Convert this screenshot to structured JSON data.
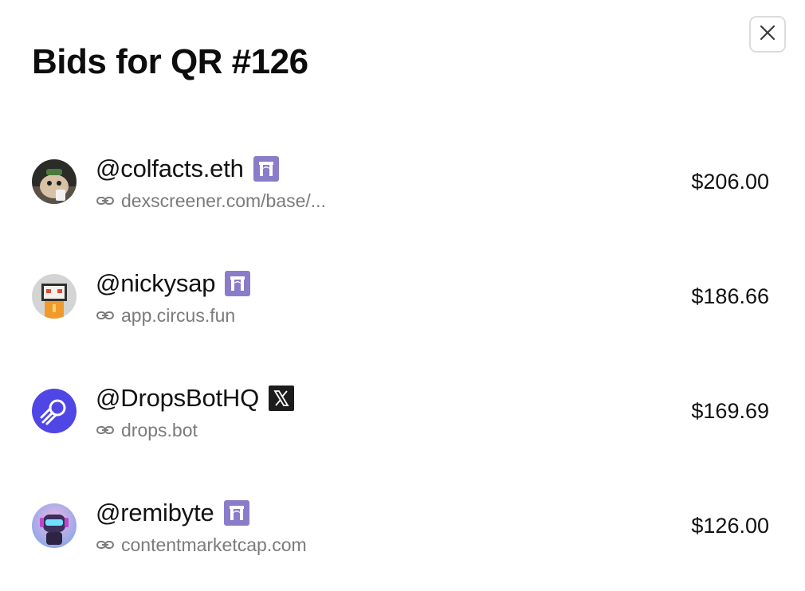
{
  "modal": {
    "title": "Bids for QR #126",
    "close_icon": "close-icon"
  },
  "bids": [
    {
      "handle": "@colfacts.eth",
      "badge": "farcaster-icon",
      "link": "dexscreener.com/base/...",
      "amount": "$206.00",
      "avatar": "hamster-avatar"
    },
    {
      "handle": "@nickysap",
      "badge": "farcaster-icon",
      "link": "app.circus.fun",
      "amount": "$186.66",
      "avatar": "pixel-character-avatar"
    },
    {
      "handle": "@DropsBotHQ",
      "badge": "x-icon",
      "link": "drops.bot",
      "amount": "$169.69",
      "avatar": "drops-logo-avatar"
    },
    {
      "handle": "@remibyte",
      "badge": "farcaster-icon",
      "link": "contentmarketcap.com",
      "amount": "$126.00",
      "avatar": "robot-avatar"
    }
  ],
  "colors": {
    "farcaster_badge": "#8a7cc9",
    "x_badge": "#1c1c1c",
    "link_text": "#7b7b7b",
    "drops_avatar": "#4f46e5"
  }
}
